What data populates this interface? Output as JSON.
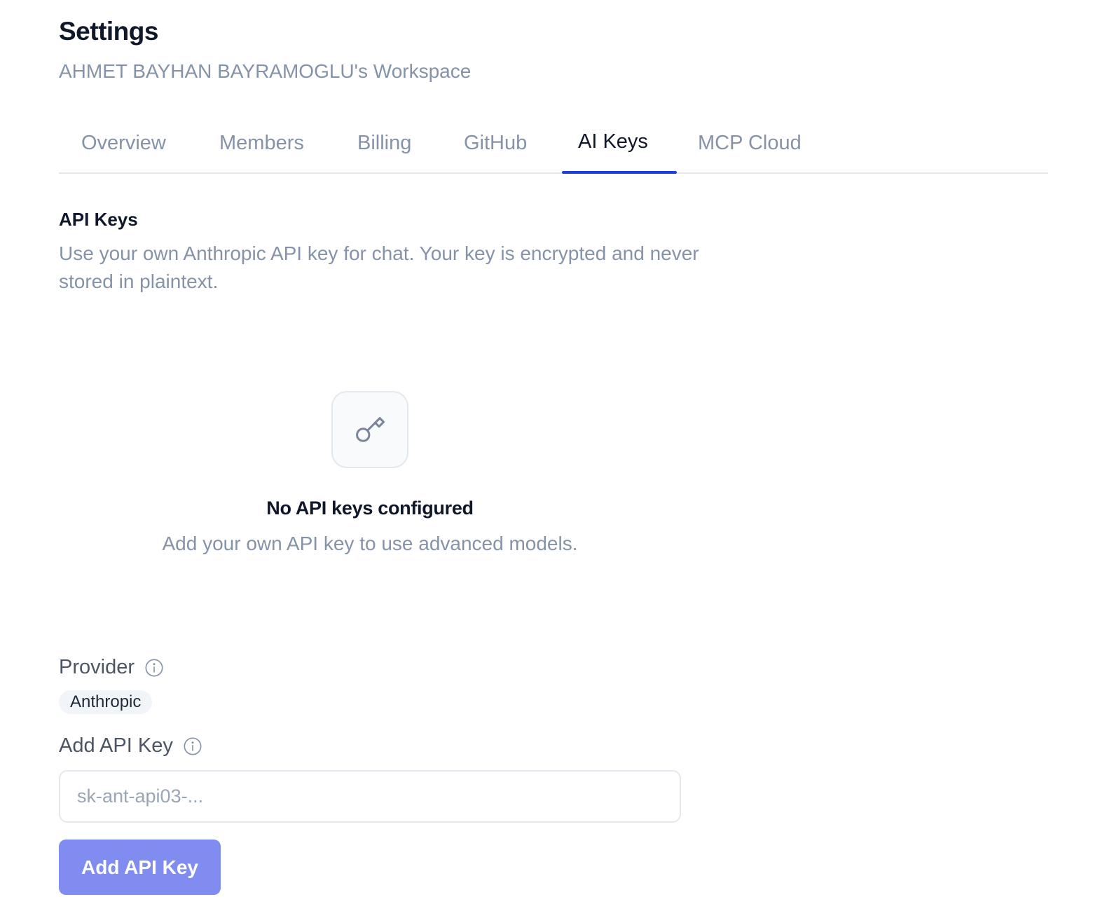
{
  "header": {
    "title": "Settings",
    "workspace": "AHMET BAYHAN BAYRAMOGLU's Workspace"
  },
  "tabs": [
    {
      "label": "Overview",
      "active": false
    },
    {
      "label": "Members",
      "active": false
    },
    {
      "label": "Billing",
      "active": false
    },
    {
      "label": "GitHub",
      "active": false
    },
    {
      "label": "AI Keys",
      "active": true
    },
    {
      "label": "MCP Cloud",
      "active": false
    }
  ],
  "api_keys": {
    "title": "API Keys",
    "description": "Use your own Anthropic API key for chat. Your key is encrypted and never stored in plaintext.",
    "empty_state": {
      "icon": "key-icon",
      "title": "No API keys configured",
      "description": "Add your own API key to use advanced models."
    }
  },
  "form": {
    "provider_label": "Provider",
    "provider_value": "Anthropic",
    "add_key_label": "Add API Key",
    "input_placeholder": "sk-ant-api03-...",
    "input_value": "",
    "submit_label": "Add API Key"
  },
  "colors": {
    "accent": "#1d3fe0",
    "button": "#818cf0",
    "muted_text": "#8593a8"
  }
}
